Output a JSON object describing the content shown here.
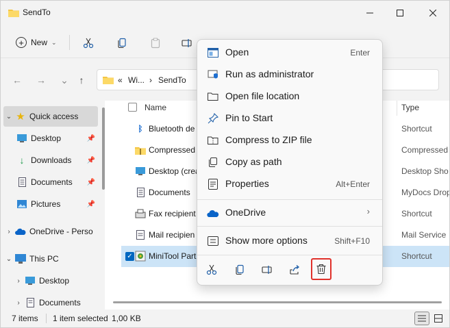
{
  "window": {
    "title": "SendTo"
  },
  "toolbar": {
    "new_label": "New",
    "more_label": "..."
  },
  "address": {
    "overflow": "«",
    "crumb1": "Wi...",
    "sep": "›",
    "crumb2": "SendTo"
  },
  "nav": {
    "quick_access": "Quick access",
    "desktop": "Desktop",
    "downloads": "Downloads",
    "documents": "Documents",
    "pictures": "Pictures",
    "onedrive": "OneDrive - Perso",
    "this_pc": "This PC",
    "pc_desktop": "Desktop",
    "pc_documents": "Documents"
  },
  "filelist": {
    "col_name": "Name",
    "col_type": "Type",
    "rows": [
      {
        "name": "Bluetooth de",
        "type": "Shortcut"
      },
      {
        "name": "Compressed",
        "type": "Compressed"
      },
      {
        "name": "Desktop (crea",
        "type": "Desktop Sho"
      },
      {
        "name": "Documents",
        "type": "MyDocs Drop"
      },
      {
        "name": "Fax recipient",
        "type": "Shortcut"
      },
      {
        "name": "Mail recipien",
        "type": "Mail Service"
      },
      {
        "name": "MiniTool Part",
        "type": "Shortcut"
      }
    ]
  },
  "status": {
    "items": "7 items",
    "selected": "1 item selected",
    "size": "1,00 KB"
  },
  "context_menu": {
    "open": "Open",
    "open_key": "Enter",
    "run_admin": "Run as administrator",
    "open_location": "Open file location",
    "pin_start": "Pin to Start",
    "compress_zip": "Compress to ZIP file",
    "copy_path": "Copy as path",
    "properties": "Properties",
    "properties_key": "Alt+Enter",
    "onedrive": "OneDrive",
    "more_options": "Show more options",
    "more_options_key": "Shift+F10"
  },
  "colors": {
    "accent": "#0067c0",
    "selection": "#cce4f7",
    "highlight": "#e0302a",
    "folder": "#f4c542"
  }
}
